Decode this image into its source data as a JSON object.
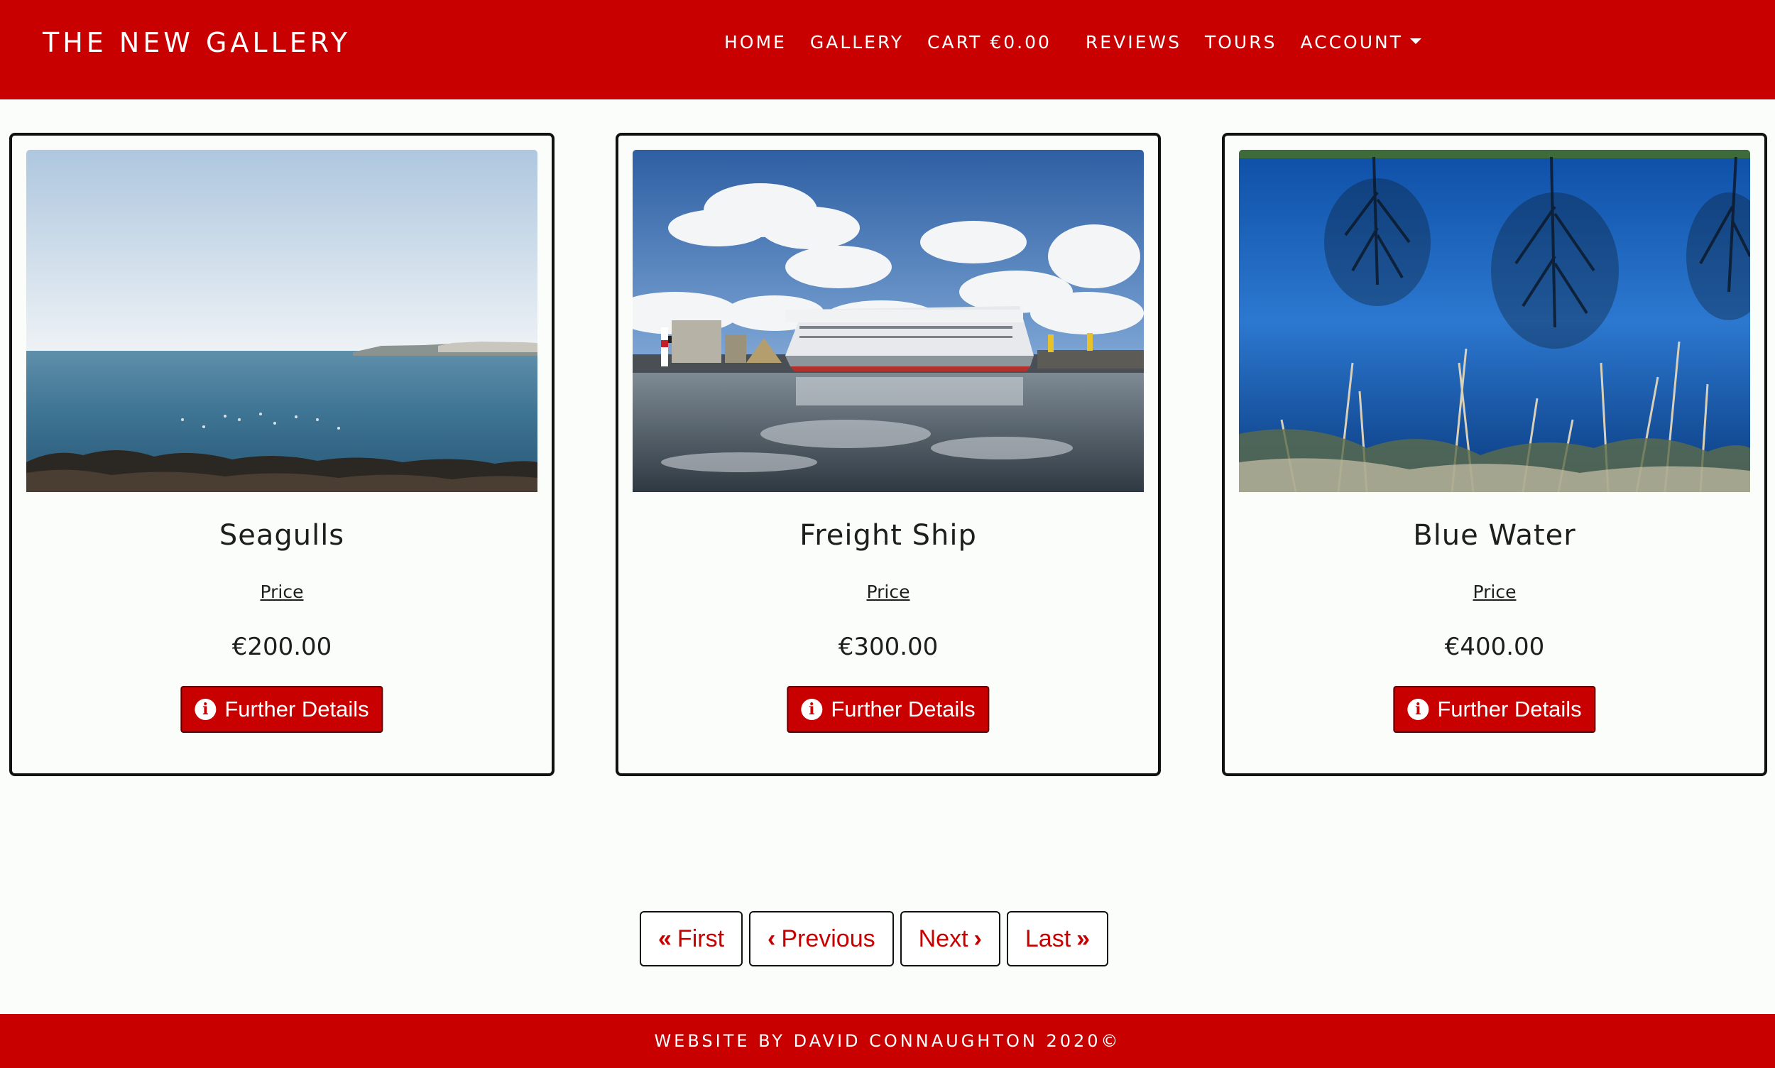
{
  "navbar": {
    "brand": "THE NEW GALLERY",
    "links": {
      "home": "HOME",
      "gallery": "GALLERY",
      "cart": "CART €0.00",
      "reviews": "REVIEWS",
      "tours": "TOURS",
      "account": "ACCOUNT"
    }
  },
  "products": [
    {
      "title": "Seagulls",
      "price_label": "Price",
      "price": "€200.00",
      "button": "Further Details"
    },
    {
      "title": "Freight Ship",
      "price_label": "Price",
      "price": "€300.00",
      "button": "Further Details"
    },
    {
      "title": "Blue Water",
      "price_label": "Price",
      "price": "€400.00",
      "button": "Further Details"
    }
  ],
  "pagination": {
    "first": "First",
    "previous": "Previous",
    "next": "Next",
    "last": "Last"
  },
  "footer": {
    "text": "WEBSITE BY DAVID CONNAUGHTON 2020©"
  },
  "colors": {
    "brand_red": "#c90000",
    "background": "#fbfdfa"
  }
}
